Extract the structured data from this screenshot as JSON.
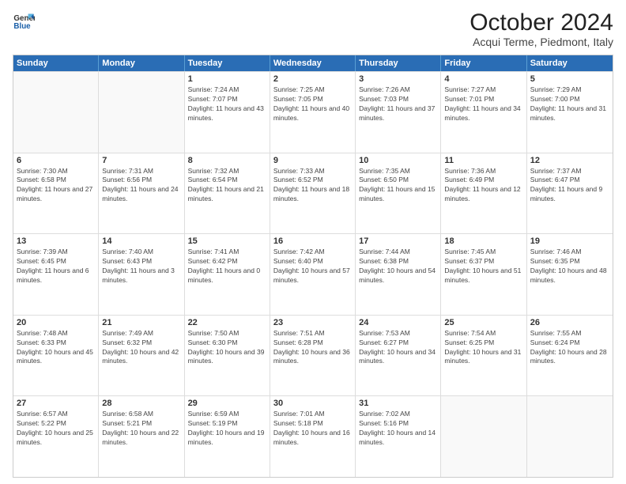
{
  "logo": {
    "line1": "General",
    "line2": "Blue"
  },
  "title": "October 2024",
  "subtitle": "Acqui Terme, Piedmont, Italy",
  "days_of_week": [
    "Sunday",
    "Monday",
    "Tuesday",
    "Wednesday",
    "Thursday",
    "Friday",
    "Saturday"
  ],
  "rows": [
    [
      {
        "day": "",
        "info": ""
      },
      {
        "day": "",
        "info": ""
      },
      {
        "day": "1",
        "info": "Sunrise: 7:24 AM\nSunset: 7:07 PM\nDaylight: 11 hours and 43 minutes."
      },
      {
        "day": "2",
        "info": "Sunrise: 7:25 AM\nSunset: 7:05 PM\nDaylight: 11 hours and 40 minutes."
      },
      {
        "day": "3",
        "info": "Sunrise: 7:26 AM\nSunset: 7:03 PM\nDaylight: 11 hours and 37 minutes."
      },
      {
        "day": "4",
        "info": "Sunrise: 7:27 AM\nSunset: 7:01 PM\nDaylight: 11 hours and 34 minutes."
      },
      {
        "day": "5",
        "info": "Sunrise: 7:29 AM\nSunset: 7:00 PM\nDaylight: 11 hours and 31 minutes."
      }
    ],
    [
      {
        "day": "6",
        "info": "Sunrise: 7:30 AM\nSunset: 6:58 PM\nDaylight: 11 hours and 27 minutes."
      },
      {
        "day": "7",
        "info": "Sunrise: 7:31 AM\nSunset: 6:56 PM\nDaylight: 11 hours and 24 minutes."
      },
      {
        "day": "8",
        "info": "Sunrise: 7:32 AM\nSunset: 6:54 PM\nDaylight: 11 hours and 21 minutes."
      },
      {
        "day": "9",
        "info": "Sunrise: 7:33 AM\nSunset: 6:52 PM\nDaylight: 11 hours and 18 minutes."
      },
      {
        "day": "10",
        "info": "Sunrise: 7:35 AM\nSunset: 6:50 PM\nDaylight: 11 hours and 15 minutes."
      },
      {
        "day": "11",
        "info": "Sunrise: 7:36 AM\nSunset: 6:49 PM\nDaylight: 11 hours and 12 minutes."
      },
      {
        "day": "12",
        "info": "Sunrise: 7:37 AM\nSunset: 6:47 PM\nDaylight: 11 hours and 9 minutes."
      }
    ],
    [
      {
        "day": "13",
        "info": "Sunrise: 7:39 AM\nSunset: 6:45 PM\nDaylight: 11 hours and 6 minutes."
      },
      {
        "day": "14",
        "info": "Sunrise: 7:40 AM\nSunset: 6:43 PM\nDaylight: 11 hours and 3 minutes."
      },
      {
        "day": "15",
        "info": "Sunrise: 7:41 AM\nSunset: 6:42 PM\nDaylight: 11 hours and 0 minutes."
      },
      {
        "day": "16",
        "info": "Sunrise: 7:42 AM\nSunset: 6:40 PM\nDaylight: 10 hours and 57 minutes."
      },
      {
        "day": "17",
        "info": "Sunrise: 7:44 AM\nSunset: 6:38 PM\nDaylight: 10 hours and 54 minutes."
      },
      {
        "day": "18",
        "info": "Sunrise: 7:45 AM\nSunset: 6:37 PM\nDaylight: 10 hours and 51 minutes."
      },
      {
        "day": "19",
        "info": "Sunrise: 7:46 AM\nSunset: 6:35 PM\nDaylight: 10 hours and 48 minutes."
      }
    ],
    [
      {
        "day": "20",
        "info": "Sunrise: 7:48 AM\nSunset: 6:33 PM\nDaylight: 10 hours and 45 minutes."
      },
      {
        "day": "21",
        "info": "Sunrise: 7:49 AM\nSunset: 6:32 PM\nDaylight: 10 hours and 42 minutes."
      },
      {
        "day": "22",
        "info": "Sunrise: 7:50 AM\nSunset: 6:30 PM\nDaylight: 10 hours and 39 minutes."
      },
      {
        "day": "23",
        "info": "Sunrise: 7:51 AM\nSunset: 6:28 PM\nDaylight: 10 hours and 36 minutes."
      },
      {
        "day": "24",
        "info": "Sunrise: 7:53 AM\nSunset: 6:27 PM\nDaylight: 10 hours and 34 minutes."
      },
      {
        "day": "25",
        "info": "Sunrise: 7:54 AM\nSunset: 6:25 PM\nDaylight: 10 hours and 31 minutes."
      },
      {
        "day": "26",
        "info": "Sunrise: 7:55 AM\nSunset: 6:24 PM\nDaylight: 10 hours and 28 minutes."
      }
    ],
    [
      {
        "day": "27",
        "info": "Sunrise: 6:57 AM\nSunset: 5:22 PM\nDaylight: 10 hours and 25 minutes."
      },
      {
        "day": "28",
        "info": "Sunrise: 6:58 AM\nSunset: 5:21 PM\nDaylight: 10 hours and 22 minutes."
      },
      {
        "day": "29",
        "info": "Sunrise: 6:59 AM\nSunset: 5:19 PM\nDaylight: 10 hours and 19 minutes."
      },
      {
        "day": "30",
        "info": "Sunrise: 7:01 AM\nSunset: 5:18 PM\nDaylight: 10 hours and 16 minutes."
      },
      {
        "day": "31",
        "info": "Sunrise: 7:02 AM\nSunset: 5:16 PM\nDaylight: 10 hours and 14 minutes."
      },
      {
        "day": "",
        "info": ""
      },
      {
        "day": "",
        "info": ""
      }
    ]
  ]
}
